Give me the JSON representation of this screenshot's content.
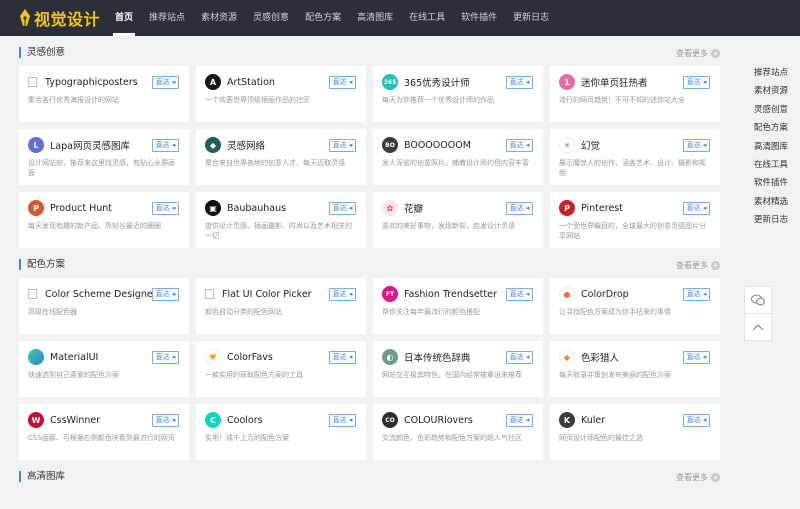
{
  "brand": {
    "logo_text": "视觉设计",
    "accent": "#f5c518"
  },
  "nav": [
    "首页",
    "推荐站点",
    "素材资源",
    "灵感创意",
    "配色方案",
    "高清图库",
    "在线工具",
    "软件插件",
    "更新日志"
  ],
  "go_label": "直达",
  "more_label": "查看更多",
  "sections": [
    {
      "title": "灵感创意",
      "cards": [
        {
          "name": "Typographicposters",
          "desc": "集合各行优秀海报设计的网站",
          "icon": "image-placeholder-icon",
          "color": "",
          "glyph": ""
        },
        {
          "name": "ArtStation",
          "desc": "一个欢荟世界顶级插画作品的社区",
          "icon": "artstation-icon",
          "color": "#13181c",
          "glyph": "A"
        },
        {
          "name": "365优秀设计师",
          "desc": "每天为你推荐一个优秀设计师的作品",
          "icon": "365-icon",
          "color": "#19c4b4",
          "glyph": "365"
        },
        {
          "name": "迷你单页狂热者",
          "desc": "流行的网页趋势！不可不知的迷你站大全",
          "icon": "onepage-icon",
          "color": "#e96aa8",
          "glyph": "1"
        },
        {
          "name": "Lapa网页灵感图库",
          "desc": "设计网站前，推荐来这里找灵感，有贴心全屏画面",
          "icon": "lapa-icon",
          "color": "#5d6fd8",
          "glyph": "L"
        },
        {
          "name": "灵感网络",
          "desc": "聚合来自世界各地的创意人才，每天迈取灵感",
          "icon": "inspiration-net-icon",
          "color": "#1f5f55",
          "glyph": "◆"
        },
        {
          "name": "BOOOOOOOM",
          "desc": "发人深省的创意照片，捕着设计简约但内容丰富",
          "icon": "booooooom-icon",
          "color": "#3b3b3b",
          "glyph": "BO"
        },
        {
          "name": "幻觉",
          "desc": "展示魔惊人的创作，涵盖艺术、设计、摄影和视频",
          "icon": "illusion-icon",
          "color": "#ffffff",
          "glyph": "✳"
        },
        {
          "name": "Product Hunt",
          "desc": "每天发现有趣的新产品、高轻谷最近的圈圈",
          "icon": "producthunt-icon",
          "color": "#da552f",
          "glyph": "P"
        },
        {
          "name": "Baubauhaus",
          "desc": "提供设计灵感、插画摄影、时尚以及艺术相关的一切",
          "icon": "baubauhaus-icon",
          "color": "#111111",
          "glyph": "▣"
        },
        {
          "name": "花瓣",
          "desc": "喜欢的美好事物，发现新知，启发设计灵感",
          "icon": "huaban-icon",
          "color": "#ffe3e6",
          "glyph": "✿"
        },
        {
          "name": "Pinterest",
          "desc": "一个受世界瞩目的，全球最大的创意灵感图片分享网站",
          "icon": "pinterest-icon",
          "color": "#cb2027",
          "glyph": "P"
        }
      ]
    },
    {
      "title": "配色方案",
      "cards": [
        {
          "name": "Color Scheme Designer",
          "desc": "高级在线配色器",
          "icon": "image-placeholder-icon",
          "color": "",
          "glyph": ""
        },
        {
          "name": "Flat UI Color Picker",
          "desc": "颜色自动分类的配色网站",
          "icon": "image-placeholder-icon",
          "color": "",
          "glyph": ""
        },
        {
          "name": "Fashion Trendsetter",
          "desc": "帮你关注每年最流行的颜色搭配",
          "icon": "fashion-trendsetter-icon",
          "color": "#e0148a",
          "glyph": "FT"
        },
        {
          "name": "ColorDrop",
          "desc": "让寻找配色方案成为信手拈来的事情",
          "icon": "colordrop-icon",
          "color": "#ffffff",
          "glyph": "●"
        },
        {
          "name": "MaterialUI",
          "desc": "快速选到自己喜爱的配色方案",
          "icon": "materialui-icon",
          "color": "#2fb9d4",
          "glyph": ""
        },
        {
          "name": "ColorFavs",
          "desc": "一款实用的获取配色方案的工具",
          "icon": "colorfavs-icon",
          "color": "#ffffff",
          "glyph": "♥"
        },
        {
          "name": "日本传统色辞典",
          "desc": "网站交互极其特色，在国内经常被拿出来推荐",
          "icon": "nipponcolors-icon",
          "color": "#6a9e86",
          "glyph": "◐"
        },
        {
          "name": "色彩猎人",
          "desc": "每天收录并策划发布美丽的配色方案",
          "icon": "colorhunt-icon",
          "color": "#ffffff",
          "glyph": "◆"
        },
        {
          "name": "CssWinner",
          "desc": "CSS画廊、可根据右侧颜色块看到最流行的网页",
          "icon": "csswinner-icon",
          "color": "#c8102e",
          "glyph": "W"
        },
        {
          "name": "Coolors",
          "desc": "实用！成千上万的配色方案",
          "icon": "coolors-icon",
          "color": "#0fd4c0",
          "glyph": "C"
        },
        {
          "name": "COLOURlovers",
          "desc": "交流颜色、色彩趋势和配色方案的超人气社区",
          "icon": "colourlovers-icon",
          "color": "#2d2d2d",
          "glyph": "CO"
        },
        {
          "name": "Kuler",
          "desc": "网页设计师配色的最佳之选",
          "icon": "kuler-icon",
          "color": "#3c3c3c",
          "glyph": "K"
        }
      ]
    },
    {
      "title": "高清图库",
      "cards": []
    }
  ],
  "sidenav": [
    "推荐站点",
    "素材资源",
    "灵感创意",
    "配色方案",
    "高清图库",
    "在线工具",
    "软件插件",
    "素材精选",
    "更新日志"
  ]
}
